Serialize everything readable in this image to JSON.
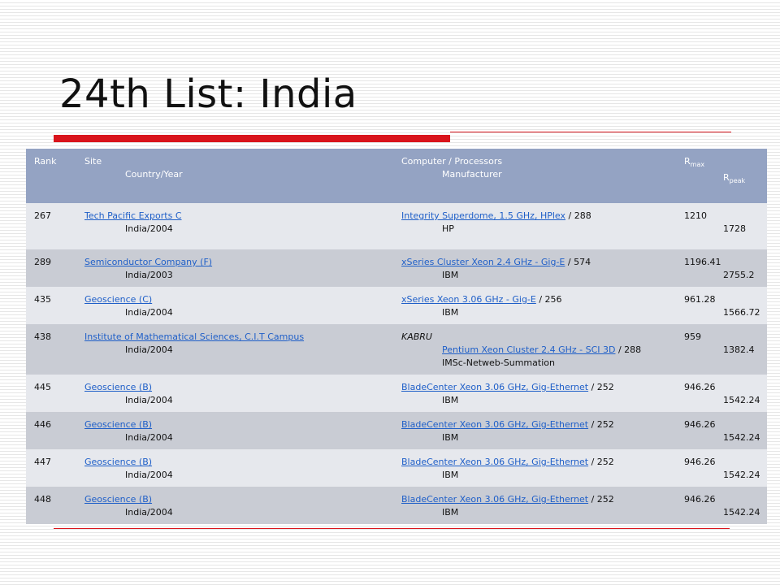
{
  "title": "24th List: India",
  "table": {
    "headers": {
      "rank": "Rank",
      "site": "Site",
      "country_year": "Country/Year",
      "computer": "Computer / Processors",
      "manufacturer": "Manufacturer",
      "rmax_base": "R",
      "rmax_sub": "max",
      "rpeak_base": "R",
      "rpeak_sub": "peak"
    },
    "rows": [
      {
        "rank": "267",
        "site": "Tech Pacific Exports C",
        "country_year": "India/2004",
        "system": "",
        "computer": "Integrity Superdome, 1.5 GHz, HPlex",
        "processors": " / 288",
        "manufacturer": "HP",
        "rmax": "1210",
        "rpeak": "1728"
      },
      {
        "rank": "289",
        "site": "Semiconductor Company (F)",
        "country_year": "India/2003",
        "system": "",
        "computer": "xSeries Cluster Xeon 2.4 GHz - Gig-E",
        "processors": " / 574",
        "manufacturer": "IBM",
        "rmax": "1196.41",
        "rpeak": "2755.2"
      },
      {
        "rank": "435",
        "site": "Geoscience (C)",
        "country_year": "India/2004",
        "system": "",
        "computer": "xSeries Xeon 3.06 GHz - Gig-E",
        "processors": " / 256",
        "manufacturer": "IBM",
        "rmax": "961.28",
        "rpeak": "1566.72"
      },
      {
        "rank": "438",
        "site": "Institute of Mathematical Sciences, C.I.T Campus",
        "country_year": "India/2004",
        "system": "KABRU",
        "computer": "Pentium Xeon Cluster 2.4 GHz - SCI 3D",
        "processors": " / 288",
        "manufacturer": "IMSc-Netweb-Summation",
        "rmax": "959",
        "rpeak": "1382.4"
      },
      {
        "rank": "445",
        "site": "Geoscience (B)",
        "country_year": "India/2004",
        "system": "",
        "computer": "BladeCenter Xeon 3.06 GHz, Gig-Ethernet",
        "processors": " / 252",
        "manufacturer": "IBM",
        "rmax": "946.26",
        "rpeak": "1542.24"
      },
      {
        "rank": "446",
        "site": "Geoscience (B)",
        "country_year": "India/2004",
        "system": "",
        "computer": "BladeCenter Xeon 3.06 GHz, Gig-Ethernet",
        "processors": " / 252",
        "manufacturer": "IBM",
        "rmax": "946.26",
        "rpeak": "1542.24"
      },
      {
        "rank": "447",
        "site": "Geoscience (B)",
        "country_year": "India/2004",
        "system": "",
        "computer": "BladeCenter Xeon 3.06 GHz, Gig-Ethernet",
        "processors": " / 252",
        "manufacturer": "IBM",
        "rmax": "946.26",
        "rpeak": "1542.24"
      },
      {
        "rank": "448",
        "site": "Geoscience (B)",
        "country_year": "India/2004",
        "system": "",
        "computer": "BladeCenter Xeon 3.06 GHz, Gig-Ethernet",
        "processors": " / 252",
        "manufacturer": "IBM",
        "rmax": "946.26",
        "rpeak": "1542.24"
      }
    ]
  },
  "colors": {
    "header_bg": "#94a3c3",
    "row_light": "#e6e8ed",
    "row_dark": "#c9ccd4",
    "accent_red": "#d9141c",
    "link": "#1f5fc8"
  }
}
